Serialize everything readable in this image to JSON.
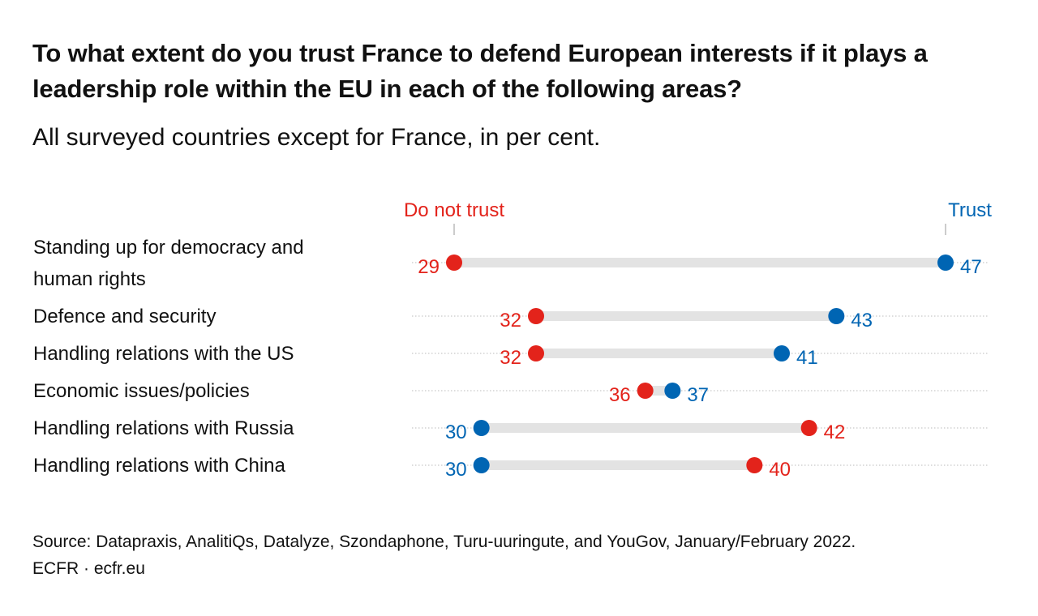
{
  "chart_data": {
    "type": "dumbbell",
    "title": "To what extent do you trust France to defend European interests if it plays a leadership role within the EU in each of the following areas?",
    "subtitle": "All surveyed countries except for France, in per cent.",
    "xlim": [
      29,
      47
    ],
    "legend": {
      "do_not_trust": {
        "label": "Do not trust",
        "color": "#e3231b"
      },
      "trust": {
        "label": "Trust",
        "color": "#0065b3"
      }
    },
    "categories": [
      "Standing up for democracy and human rights",
      "Defence and security",
      "Handling relations with the US",
      "Economic issues/policies",
      "Handling relations with Russia",
      "Handling relations with China"
    ],
    "category_lines": [
      [
        "Standing up for democracy and",
        "human rights"
      ],
      [
        "Defence and security"
      ],
      [
        "Handling relations with the US"
      ],
      [
        "Economic issues/policies"
      ],
      [
        "Handling relations with Russia"
      ],
      [
        "Handling relations with China"
      ]
    ],
    "series": [
      {
        "name": "Do not trust",
        "color": "#e3231b",
        "values": [
          29,
          32,
          32,
          36,
          42,
          40
        ]
      },
      {
        "name": "Trust",
        "color": "#0065b3",
        "values": [
          47,
          43,
          41,
          37,
          30,
          30
        ]
      }
    ],
    "source": "Source: Datapraxis, AnalitiQs, Datalyze, Szondaphone, Turu-uuringute, and YouGov, January/February 2022.",
    "credit": "ECFR · ecfr.eu"
  }
}
